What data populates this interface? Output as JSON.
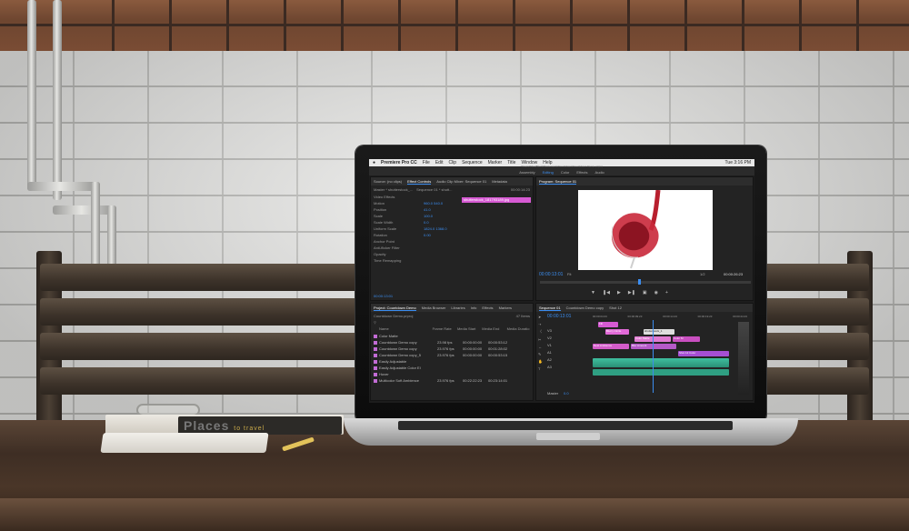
{
  "scene": {
    "book_title": "Places",
    "book_subtitle": "to travel"
  },
  "app": {
    "name": "Premiere Pro CC",
    "menu": [
      "File",
      "Edit",
      "Clip",
      "Sequence",
      "Marker",
      "Title",
      "Window",
      "Help"
    ],
    "clock": "Tue 3:16 PM",
    "workspaces": [
      "Assembly",
      "Editing",
      "Color",
      "Effects",
      "Audio"
    ],
    "active_workspace": "Editing",
    "path": "/Users/Cleal/Work/Documents/Countdown/Countdown Demo.prproj"
  },
  "source_panel": {
    "tabs": [
      "Source: (no clips)",
      "Effect Controls",
      "Audio Clip Mixer: Sequence 01",
      "Metadata"
    ],
    "active_tab": "Effect Controls",
    "master": "Master * shutterstock_...",
    "sequence": "Sequence 01 * shutt...",
    "clip_label": "shutterstock_181793189.jpg",
    "timecode_start": "00:00:14:23",
    "rows": [
      "Video Effects",
      "Motion",
      "Position",
      "Scale",
      "Scale Width",
      "Uniform Scale",
      "Rotation",
      "Anchor Point",
      "Anti-flicker Filter",
      "Opacity",
      "Time Remapping"
    ],
    "values": [
      "960.0  540.0",
      "41.0",
      "100.0",
      "",
      "0.0",
      "1824.0  1368.0",
      "0.00"
    ],
    "footer_time": "00:00:13:01"
  },
  "program_panel": {
    "title": "Program: Sequence 01",
    "timecode_left": "00:00:13:01",
    "fit": "Fit",
    "quality": "1/2",
    "timecode_right": "00:00:26:23"
  },
  "project_panel": {
    "tabs": [
      "Project: Countdown Demo",
      "Media Browser",
      "Libraries",
      "Info",
      "Effects",
      "Markers"
    ],
    "file": "Countdown Demo.prproj",
    "item_count": "47 Items",
    "columns": [
      "Name",
      "Frame Rate",
      "Media Start",
      "Media End",
      "Media Duratio"
    ],
    "items": [
      {
        "name": "Color Matte",
        "rate": "",
        "start": "",
        "end": ""
      },
      {
        "name": "Countdown Demo copy",
        "rate": "23.98 fps",
        "start": "00:00:00:00",
        "end": "00:00:53:12"
      },
      {
        "name": "Countdown Demo copy",
        "rate": "23.976 fps",
        "start": "00:00:00:00",
        "end": "00:01:28:02"
      },
      {
        "name": "Countdown Demo copy_5",
        "rate": "23.976 fps",
        "start": "00:00:00:00",
        "end": "00:00:53:15"
      },
      {
        "name": "Easily Adjustable",
        "rate": "",
        "start": "",
        "end": ""
      },
      {
        "name": "Easily Adjustable Color El",
        "rate": "",
        "start": "",
        "end": ""
      },
      {
        "name": "Hover",
        "rate": "",
        "start": "",
        "end": ""
      },
      {
        "name": "Multicolor Soft Ambience",
        "rate": "23.976 fps",
        "start": "00:22:22:23",
        "end": "00:23:14:01"
      }
    ]
  },
  "timeline_panel": {
    "tabs": [
      "Sequence 01",
      "Countdown Demo copy",
      "Shot 12"
    ],
    "timecode": "00:00:13:01",
    "ruler": [
      "00:00:04:23",
      "00:00:09:23",
      "00:00:14:23",
      "00:00:19:23",
      "00:00:24:23"
    ],
    "tracks": [
      "V3",
      "V2",
      "V1",
      "A1",
      "A2",
      "A3"
    ],
    "clips": [
      "Fill",
      "Blurry Circle",
      "Color Matte",
      "Nest Ambience",
      "Blur Amount",
      "shutterstock_1",
      "Shot 12 Color",
      "Color M"
    ],
    "master": "Master",
    "master_value": "0.0"
  }
}
